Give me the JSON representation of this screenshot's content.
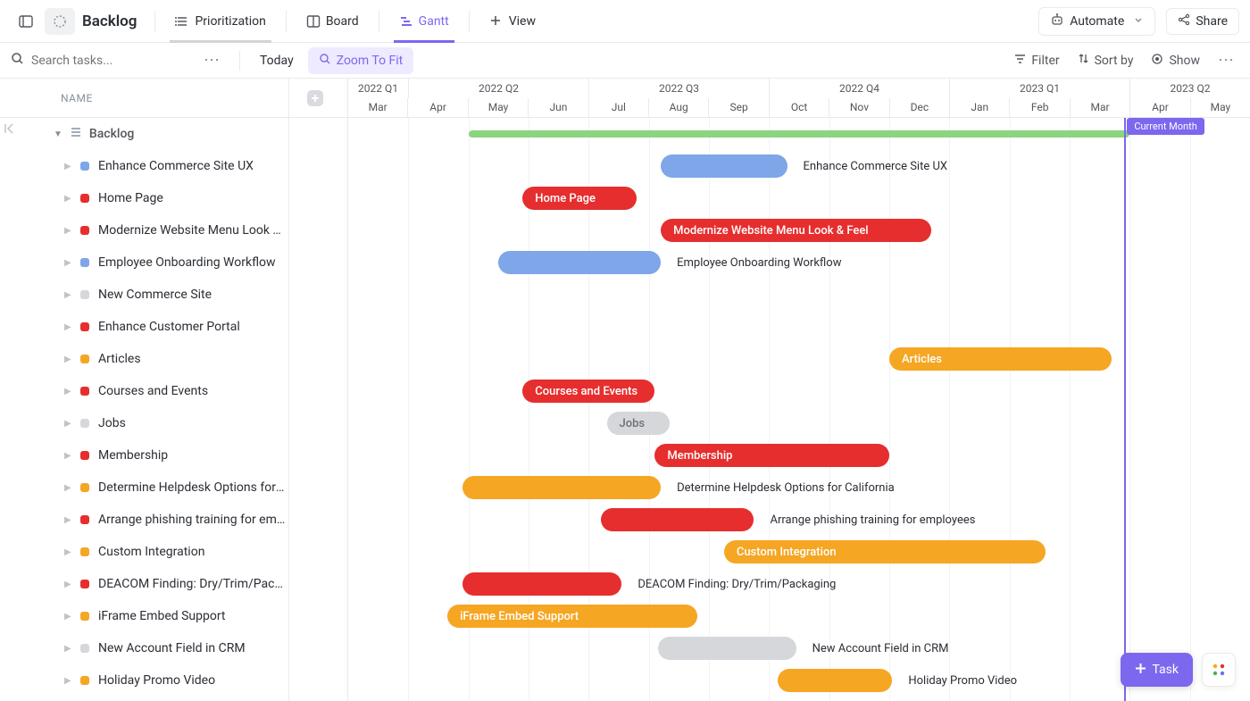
{
  "header": {
    "title": "Backlog",
    "tabs": [
      {
        "label": "Prioritization",
        "icon": "list-prio"
      },
      {
        "label": "Board",
        "icon": "board"
      },
      {
        "label": "Gantt",
        "icon": "gantt"
      },
      {
        "label": "View",
        "icon": "plus"
      }
    ],
    "automate_label": "Automate",
    "share_label": "Share"
  },
  "subbar": {
    "search_placeholder": "Search tasks...",
    "today_label": "Today",
    "zoom_label": "Zoom To Fit",
    "filter_label": "Filter",
    "sortby_label": "Sort by",
    "show_label": "Show"
  },
  "tasklist": {
    "name_header": "NAME",
    "group_label": "Backlog"
  },
  "timeline": {
    "quarters": [
      "2022 Q1",
      "2022 Q2",
      "2022 Q3",
      "2022 Q4",
      "2023 Q1",
      "2023 Q2"
    ],
    "months": [
      "Mar",
      "Apr",
      "May",
      "Jun",
      "Jul",
      "Aug",
      "Sep",
      "Oct",
      "Nov",
      "Dec",
      "Jan",
      "Feb",
      "Mar",
      "Apr",
      "May"
    ],
    "current_month_label": "Current Month"
  },
  "colors": {
    "red": "#e62e2e",
    "blue": "#7ea6e8",
    "orange": "#f5a623",
    "gray": "#c9ccd1",
    "lightgray": "#d5d7db",
    "green": "#8cd47e"
  },
  "chart_data": {
    "type": "gantt",
    "time_axis": {
      "start": "2022-03",
      "end": "2023-05",
      "unit": "month"
    },
    "months": [
      "Mar",
      "Apr",
      "May",
      "Jun",
      "Jul",
      "Aug",
      "Sep",
      "Oct",
      "Nov",
      "Dec",
      "Jan",
      "Feb",
      "Mar",
      "Apr",
      "May"
    ],
    "summary": {
      "label": "Backlog",
      "start": 2.0,
      "end": 13.0
    },
    "tasks": [
      {
        "name": "Enhance Commerce Site UX",
        "color": "blue",
        "bar_start": 5.2,
        "bar_end": 7.3,
        "label_after": true
      },
      {
        "name": "Home Page",
        "color": "red",
        "bar_start": 2.9,
        "bar_end": 4.8,
        "label_inside": true
      },
      {
        "name": "Modernize Website Menu Look & ...",
        "full_name": "Modernize Website Menu Look & Feel",
        "color": "red",
        "bar_start": 5.2,
        "bar_end": 9.7,
        "label_inside": true
      },
      {
        "name": "Employee Onboarding Workflow",
        "color": "blue",
        "bar_start": 2.5,
        "bar_end": 5.2,
        "label_after": true
      },
      {
        "name": "New Commerce Site",
        "color": "lightgray",
        "no_bar": true
      },
      {
        "name": "Enhance Customer Portal",
        "color": "red",
        "no_bar": true
      },
      {
        "name": "Articles",
        "color": "orange",
        "bar_start": 9.0,
        "bar_end": 12.7,
        "label_inside": true
      },
      {
        "name": "Courses and Events",
        "color": "red",
        "bar_start": 2.9,
        "bar_end": 5.1,
        "label_inside": true
      },
      {
        "name": "Jobs",
        "color": "lightgray",
        "bar_start": 4.3,
        "bar_end": 5.35,
        "label_inside": true,
        "text_gray": true
      },
      {
        "name": "Membership",
        "color": "red",
        "bar_start": 5.1,
        "bar_end": 9.0,
        "label_inside": true
      },
      {
        "name": "Determine Helpdesk Options for C...",
        "full_name": "Determine Helpdesk Options for California",
        "color": "orange",
        "bar_start": 1.9,
        "bar_end": 5.2,
        "label_after": true
      },
      {
        "name": "Arrange phishing training for empl...",
        "full_name": "Arrange phishing training for employees",
        "color": "red",
        "bar_start": 4.2,
        "bar_end": 6.75,
        "label_after": true
      },
      {
        "name": "Custom Integration",
        "color": "orange",
        "bar_start": 6.25,
        "bar_end": 11.6,
        "label_inside": true
      },
      {
        "name": "DEACOM Finding: Dry/Trim/Packa...",
        "full_name": "DEACOM Finding: Dry/Trim/Packaging",
        "color": "red",
        "bar_start": 1.9,
        "bar_end": 4.55,
        "label_after": true
      },
      {
        "name": "iFrame Embed Support",
        "color": "orange",
        "bar_start": 1.65,
        "bar_end": 5.8,
        "label_inside": true
      },
      {
        "name": "New Account Field in CRM",
        "color": "lightgray",
        "bar_start": 5.15,
        "bar_end": 7.45,
        "label_after": true,
        "text_gray": false
      },
      {
        "name": "Holiday Promo Video",
        "color": "orange",
        "bar_start": 7.15,
        "bar_end": 9.05,
        "label_after": true
      }
    ]
  },
  "fab": {
    "task_label": "Task"
  }
}
